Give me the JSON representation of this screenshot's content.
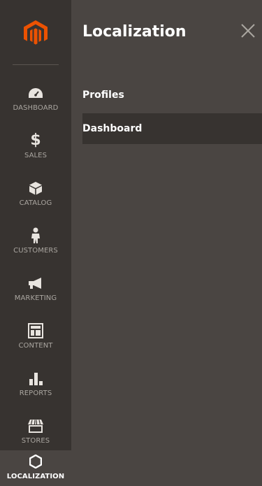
{
  "sidebar": {
    "items": [
      {
        "label": "DASHBOARD",
        "icon": "dashboard-icon"
      },
      {
        "label": "SALES",
        "icon": "dollar-icon"
      },
      {
        "label": "CATALOG",
        "icon": "box-icon"
      },
      {
        "label": "CUSTOMERS",
        "icon": "person-icon"
      },
      {
        "label": "MARKETING",
        "icon": "megaphone-icon"
      },
      {
        "label": "CONTENT",
        "icon": "layout-icon"
      },
      {
        "label": "REPORTS",
        "icon": "bar-chart-icon"
      },
      {
        "label": "STORES",
        "icon": "storefront-icon"
      },
      {
        "label": "LOCALIZATION",
        "icon": "hexagon-icon"
      }
    ],
    "active": "LOCALIZATION"
  },
  "panel": {
    "title": "Localization",
    "links": [
      {
        "label": "Profiles"
      },
      {
        "label": "Dashboard"
      }
    ],
    "active_link": "Dashboard"
  },
  "colors": {
    "sidebar_bg": "#373330",
    "panel_bg": "#4a4542",
    "brand_orange": "#eb5202",
    "label_gray": "#aaa6a0"
  }
}
